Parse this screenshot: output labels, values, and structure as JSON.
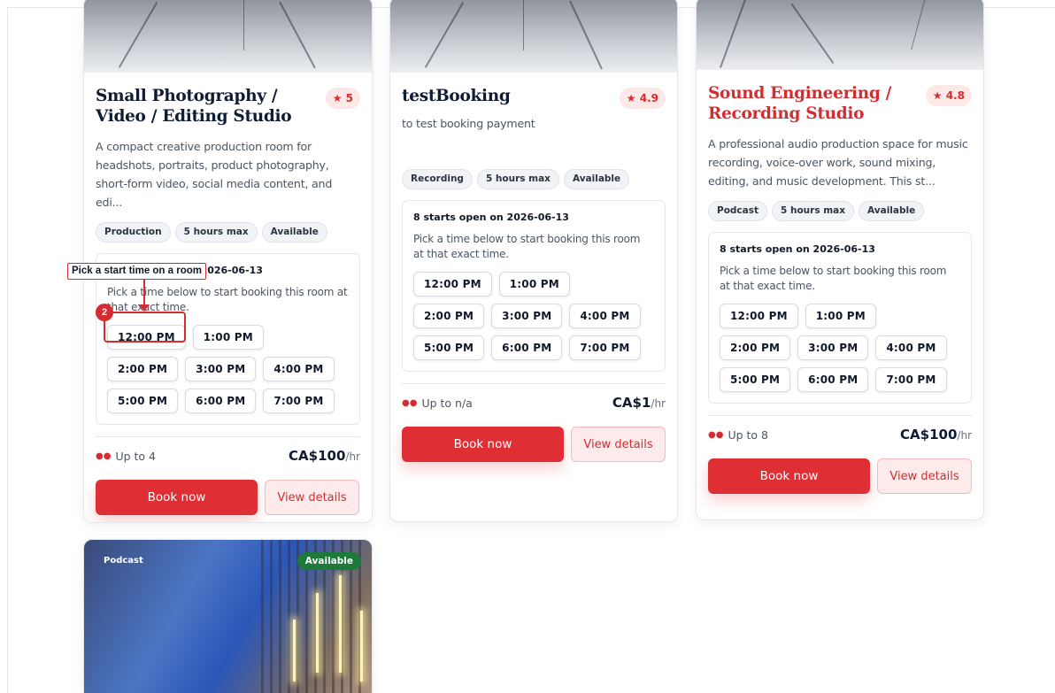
{
  "cards": [
    {
      "title": "Small Photography / Video / Editing Studio",
      "rating": "★ 5",
      "description": "A compact creative production room for headshots, portraits, product photography, short-form video, social media content, and edi...",
      "tags": [
        "Production",
        "5 hours max",
        "Available"
      ],
      "slots_heading": "8 starts open on 2026-06-13",
      "slots_text": "Pick a time below to start booking this room at that exact time.",
      "slots": [
        "12:00 PM",
        "1:00 PM",
        "2:00 PM",
        "3:00 PM",
        "4:00 PM",
        "5:00 PM",
        "6:00 PM",
        "7:00 PM"
      ],
      "capacity": "Up to 4",
      "price": "CA$100",
      "price_unit": "/hr",
      "book_label": "Book now",
      "view_label": "View details"
    },
    {
      "title": "testBooking",
      "rating": "★ 4.9",
      "description": "to test booking payment",
      "tags": [
        "Recording",
        "5 hours max",
        "Available"
      ],
      "slots_heading": "8 starts open on 2026-06-13",
      "slots_text": "Pick a time below to start booking this room at that exact time.",
      "slots": [
        "12:00 PM",
        "1:00 PM",
        "2:00 PM",
        "3:00 PM",
        "4:00 PM",
        "5:00 PM",
        "6:00 PM",
        "7:00 PM"
      ],
      "capacity": "Up to n/a",
      "price": "CA$1",
      "price_unit": "/hr",
      "book_label": "Book now",
      "view_label": "View details"
    },
    {
      "title": "Sound Engineering / Recording Studio",
      "rating": "★ 4.8",
      "description": "A professional audio production space for music recording, voice-over work, sound mixing, editing, and music development. This st...",
      "tags": [
        "Podcast",
        "5 hours max",
        "Available"
      ],
      "slots_heading": "8 starts open on 2026-06-13",
      "slots_text": "Pick a time below to start booking this room at that exact time.",
      "slots": [
        "12:00 PM",
        "1:00 PM",
        "2:00 PM",
        "3:00 PM",
        "4:00 PM",
        "5:00 PM",
        "6:00 PM",
        "7:00 PM"
      ],
      "capacity": "Up to 8",
      "price": "CA$100",
      "price_unit": "/hr",
      "book_label": "Book now",
      "view_label": "View details"
    }
  ],
  "photo_card": {
    "category": "Podcast",
    "status": "Available"
  },
  "annotation": {
    "label": "Pick a start time on a room",
    "step": "2"
  },
  "colors": {
    "accent": "#e02f34",
    "available_badge": "#1d7a3a"
  }
}
